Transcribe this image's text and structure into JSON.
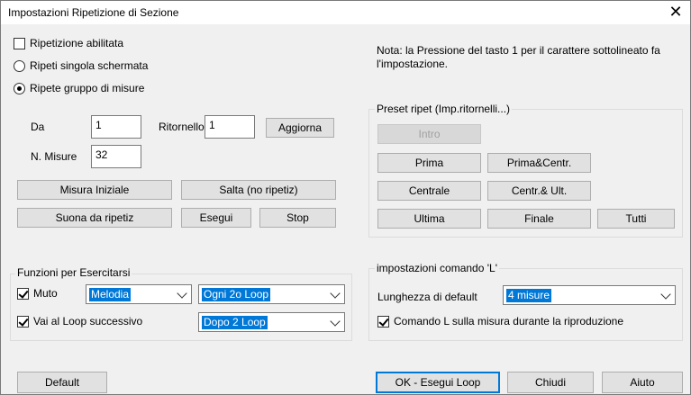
{
  "window": {
    "title": "Impostazioni Ripetizione di Sezione",
    "close_glyph": "✕"
  },
  "note": {
    "line1": "Nota: la Pressione del tasto 1 per il carattere sottolineato fa",
    "line2": "l'impostazione."
  },
  "options": {
    "enabled_label": "Ripetizione abilitata",
    "single_screen_label": "Ripeti singola schermata",
    "group_label": "Ripete gruppo di misure"
  },
  "fields": {
    "from_label": "Da",
    "from_value": "1",
    "refrain_label": "Ritornello",
    "refrain_value": "1",
    "measures_label": "N. Misure",
    "measures_value": "32"
  },
  "buttons": {
    "update": "Aggiorna",
    "start_measure": "Misura Iniziale",
    "skip": "Salta (no ripetiz)",
    "play_from_repeat": "Suona da ripetiz",
    "run": "Esegui",
    "stop": "Stop",
    "default": "Default",
    "ok": "OK - Esegui Loop",
    "close": "Chiudi",
    "help": "Aiuto"
  },
  "preset": {
    "legend": "Preset ripet (Imp.ritornelli...)",
    "intro": "Intro",
    "first": "Prima",
    "first_center": "Prima&Centr.",
    "center": "Centrale",
    "center_last": "Centr.& Ult.",
    "last": "Ultima",
    "final": "Finale",
    "all": "Tutti"
  },
  "practice": {
    "legend": "Funzioni per Esercitarsi",
    "mute_label": "Muto",
    "mute_track": "Melodia",
    "mute_when": "Ogni 2o Loop",
    "next_loop_label": "Vai al Loop successivo",
    "next_loop_when": "Dopo 2 Loop"
  },
  "lcommand": {
    "legend": "impostazioni comando 'L'",
    "length_label": "Lunghezza di default",
    "length_value": "4 misure",
    "during_play_label": "Comando L sulla misura durante la riproduzione"
  },
  "icons": {
    "close": "close-icon",
    "dropdown": "chevron-down-icon",
    "check": "check-icon"
  }
}
